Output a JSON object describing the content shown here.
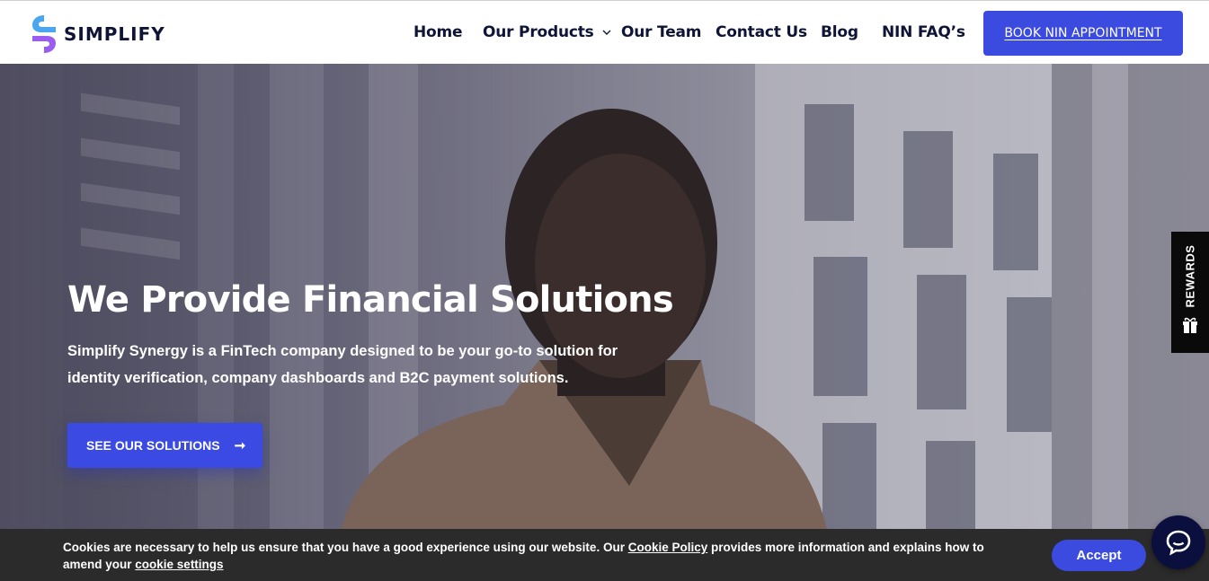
{
  "brand": {
    "name": "SIMPLIFY",
    "colors": {
      "primary": "#3b4be0",
      "navy": "#0f1436"
    }
  },
  "nav": {
    "items": [
      {
        "label": "Home"
      },
      {
        "label": "Our Products",
        "has_dropdown": true
      },
      {
        "label": "Our Team"
      },
      {
        "label": "Contact Us"
      },
      {
        "label": "Blog"
      },
      {
        "label": "NIN FAQ’s"
      }
    ],
    "cta_label": "BOOK NIN APPOINTMENT"
  },
  "hero": {
    "title": "We Provide Financial Solutions",
    "description": "Simplify Synergy is a FinTech company designed to be your go-to solution for identity verification, company dashboards and B2C payment solutions.",
    "button_label": "SEE OUR SOLUTIONS",
    "button_icon": "arrow-right-icon"
  },
  "rewards": {
    "label": "REWARDS",
    "icon": "gift-icon"
  },
  "cookie": {
    "text_part1": "Cookies are necessary to help us ensure that you have a good experience using our website. Our ",
    "link1": "Cookie Policy",
    "text_part2": " provides more information and explains how to amend your ",
    "link2": "cookie settings",
    "accept_label": "Accept"
  },
  "chat": {
    "icon": "chat-bubble-icon"
  }
}
